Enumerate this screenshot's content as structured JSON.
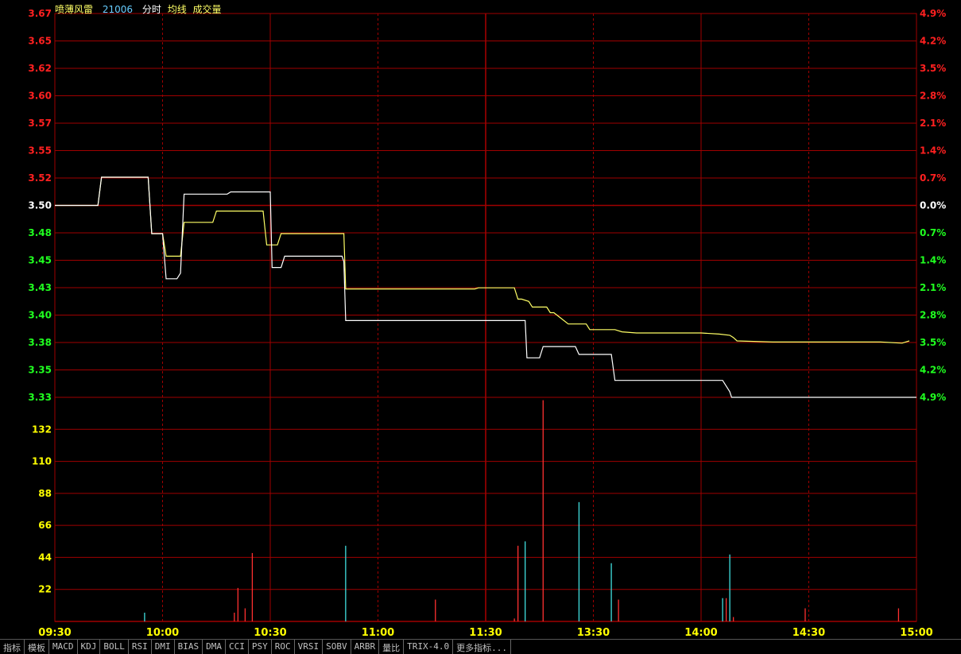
{
  "header": {
    "name": "喷薄风雷",
    "code": "21006",
    "labels": [
      "分时",
      "均线",
      "成交量"
    ]
  },
  "toolbar": {
    "tabs": [
      "指标",
      "模板",
      "MACD",
      "KDJ",
      "BOLL",
      "RSI",
      "DMI",
      "BIAS",
      "DMA",
      "CCI",
      "PSY",
      "ROC",
      "VRSI",
      "SOBV",
      "ARBR",
      "量比",
      "TRIX-4.0",
      "更多指标..."
    ]
  },
  "colors": {
    "background": "#000000",
    "grid": "#a00000",
    "price_line": "#ffffff",
    "avg_line": "#ffff66",
    "up": "#ff2020",
    "down": "#20ff20",
    "volume_label": "#ffff00",
    "volume_up": "#ff3030",
    "volume_down": "#40e0e0"
  },
  "chart_data": [
    {
      "type": "line",
      "title": "分时",
      "x_ticks": [
        "09:30",
        "10:00",
        "10:30",
        "11:00",
        "11:30",
        "13:30",
        "14:00",
        "14:30",
        "15:00"
      ],
      "prev_close": 3.5,
      "ylim": [
        3.33,
        3.67
      ],
      "y_ticks": [
        "3.67",
        "3.65",
        "3.62",
        "3.60",
        "3.57",
        "3.55",
        "3.52",
        "3.50",
        "3.48",
        "3.45",
        "3.43",
        "3.40",
        "3.38",
        "3.35",
        "3.33"
      ],
      "pct_ticks": [
        "4.9%",
        "4.2%",
        "3.5%",
        "2.8%",
        "2.1%",
        "1.4%",
        "0.7%",
        "0.0%",
        "0.7%",
        "1.4%",
        "2.1%",
        "2.8%",
        "3.5%",
        "4.2%",
        "4.9%"
      ],
      "series": [
        {
          "name": "分时",
          "points": [
            [
              0,
              3.5
            ],
            [
              12,
              3.5
            ],
            [
              13,
              3.525
            ],
            [
              25,
              3.525
            ],
            [
              26,
              3.525
            ],
            [
              27,
              3.475
            ],
            [
              30,
              3.475
            ],
            [
              31,
              3.455
            ],
            [
              32,
              3.455
            ],
            [
              33,
              3.455
            ],
            [
              34,
              3.455
            ],
            [
              35,
              3.455
            ],
            [
              36,
              3.485
            ],
            [
              42,
              3.485
            ],
            [
              44,
              3.485
            ],
            [
              45,
              3.495
            ],
            [
              51,
              3.495
            ],
            [
              58,
              3.495
            ],
            [
              59,
              3.465
            ],
            [
              60,
              3.465
            ],
            [
              62,
              3.465
            ],
            [
              63,
              3.475
            ],
            [
              64,
              3.475
            ],
            [
              80,
              3.475
            ],
            [
              80.5,
              3.475
            ],
            [
              81,
              3.426
            ],
            [
              91,
              3.426
            ],
            [
              104,
              3.426
            ],
            [
              116,
              3.426
            ],
            [
              117,
              3.426
            ],
            [
              118,
              3.427
            ],
            [
              128,
              3.427
            ],
            [
              129,
              3.417
            ],
            [
              130,
              3.417
            ],
            [
              132,
              3.415
            ],
            [
              133,
              3.41
            ],
            [
              134,
              3.41
            ],
            [
              137,
              3.41
            ],
            [
              138,
              3.405
            ],
            [
              139,
              3.405
            ],
            [
              141,
              3.4
            ],
            [
              143,
              3.395
            ],
            [
              148,
              3.395
            ],
            [
              149,
              3.39
            ],
            [
              150,
              3.39
            ],
            [
              156,
              3.39
            ],
            [
              158,
              3.388
            ],
            [
              162,
              3.387
            ],
            [
              180,
              3.387
            ],
            [
              185,
              3.386
            ],
            [
              188,
              3.385
            ],
            [
              189,
              3.383
            ],
            [
              190,
              3.38
            ],
            [
              200,
              3.379
            ],
            [
              230,
              3.379
            ],
            [
              236,
              3.378
            ],
            [
              238,
              3.38
            ]
          ]
        },
        {
          "name": "均线",
          "points": [
            [
              0,
              3.5
            ],
            [
              12,
              3.5
            ],
            [
              13,
              3.525
            ],
            [
              25,
              3.525
            ],
            [
              26,
              3.525
            ],
            [
              27,
              3.475
            ],
            [
              30,
              3.475
            ],
            [
              31,
              3.435
            ],
            [
              32,
              3.435
            ],
            [
              34,
              3.435
            ],
            [
              35,
              3.44
            ],
            [
              36,
              3.51
            ],
            [
              45,
              3.51
            ],
            [
              46,
              3.51
            ],
            [
              47,
              3.51
            ],
            [
              48,
              3.51
            ],
            [
              49,
              3.512
            ],
            [
              50,
              3.512
            ],
            [
              51,
              3.512
            ],
            [
              52,
              3.512
            ],
            [
              53,
              3.512
            ],
            [
              54,
              3.512
            ],
            [
              55,
              3.512
            ],
            [
              56,
              3.512
            ],
            [
              57,
              3.512
            ],
            [
              58,
              3.512
            ],
            [
              59,
              3.512
            ],
            [
              60,
              3.512
            ],
            [
              60.5,
              3.445
            ],
            [
              63,
              3.445
            ],
            [
              64,
              3.455
            ],
            [
              65,
              3.455
            ],
            [
              80,
              3.455
            ],
            [
              80.5,
              3.45
            ],
            [
              81,
              3.398
            ],
            [
              91,
              3.398
            ],
            [
              104,
              3.398
            ],
            [
              116,
              3.398
            ],
            [
              128,
              3.398
            ],
            [
              129,
              3.398
            ],
            [
              130,
              3.398
            ],
            [
              131,
              3.398
            ],
            [
              131.5,
              3.365
            ],
            [
              135,
              3.365
            ],
            [
              136,
              3.375
            ],
            [
              145,
              3.375
            ],
            [
              146,
              3.368
            ],
            [
              155,
              3.368
            ],
            [
              156,
              3.345
            ],
            [
              175,
              3.345
            ],
            [
              185,
              3.345
            ],
            [
              186,
              3.345
            ],
            [
              187,
              3.34
            ],
            [
              188,
              3.335
            ],
            [
              188.5,
              3.33
            ],
            [
              240,
              3.33
            ]
          ]
        }
      ]
    },
    {
      "type": "bar",
      "title": "成交量",
      "ylim": [
        0,
        154
      ],
      "y_ticks": [
        "132",
        "110",
        "88",
        "66",
        "44",
        "22"
      ],
      "bars": [
        [
          25,
          6,
          "down"
        ],
        [
          50,
          6,
          "up"
        ],
        [
          51,
          23,
          "up"
        ],
        [
          53,
          9,
          "up"
        ],
        [
          55,
          47,
          "up"
        ],
        [
          81,
          52,
          "down"
        ],
        [
          106,
          15,
          "up"
        ],
        [
          128,
          2,
          "up"
        ],
        [
          129,
          52,
          "up"
        ],
        [
          131,
          55,
          "down"
        ],
        [
          136,
          152,
          "up"
        ],
        [
          146,
          82,
          "down"
        ],
        [
          155,
          40,
          "down"
        ],
        [
          157,
          15,
          "up"
        ],
        [
          186,
          16,
          "down"
        ],
        [
          187,
          16,
          "up"
        ],
        [
          188,
          46,
          "down"
        ],
        [
          189,
          3,
          "up"
        ],
        [
          209,
          9,
          "up"
        ],
        [
          235,
          9,
          "up"
        ]
      ]
    }
  ]
}
